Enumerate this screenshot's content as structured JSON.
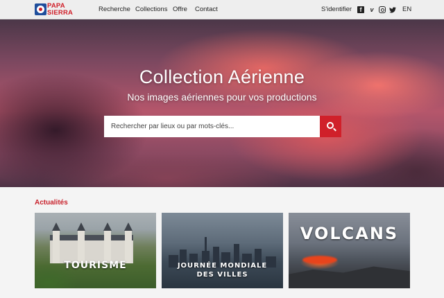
{
  "brand": {
    "line1": "PAPA",
    "line2": "SIERRA"
  },
  "nav": {
    "items": [
      "Recherche",
      "Collections",
      "Offre",
      "Contact"
    ],
    "login": "S'identifier",
    "social_icons": [
      "facebook-icon",
      "vimeo-icon",
      "instagram-icon",
      "twitter-icon"
    ],
    "language": "EN"
  },
  "hero": {
    "title": "Collection Aérienne",
    "subtitle": "Nos images aériennes pour vos productions",
    "search_placeholder": "Rechercher par lieux ou par mots-clés..."
  },
  "news": {
    "title": "Actualités",
    "cards": [
      {
        "label": "TOURISME"
      },
      {
        "label_line1": "JOURNÉE MONDIALE",
        "label_line2": "DES VILLES"
      },
      {
        "label": "VOLCANS"
      }
    ]
  },
  "colors": {
    "accent": "#d0202a",
    "header_bg": "#eeeeee",
    "page_bg": "#f4f4f4"
  }
}
